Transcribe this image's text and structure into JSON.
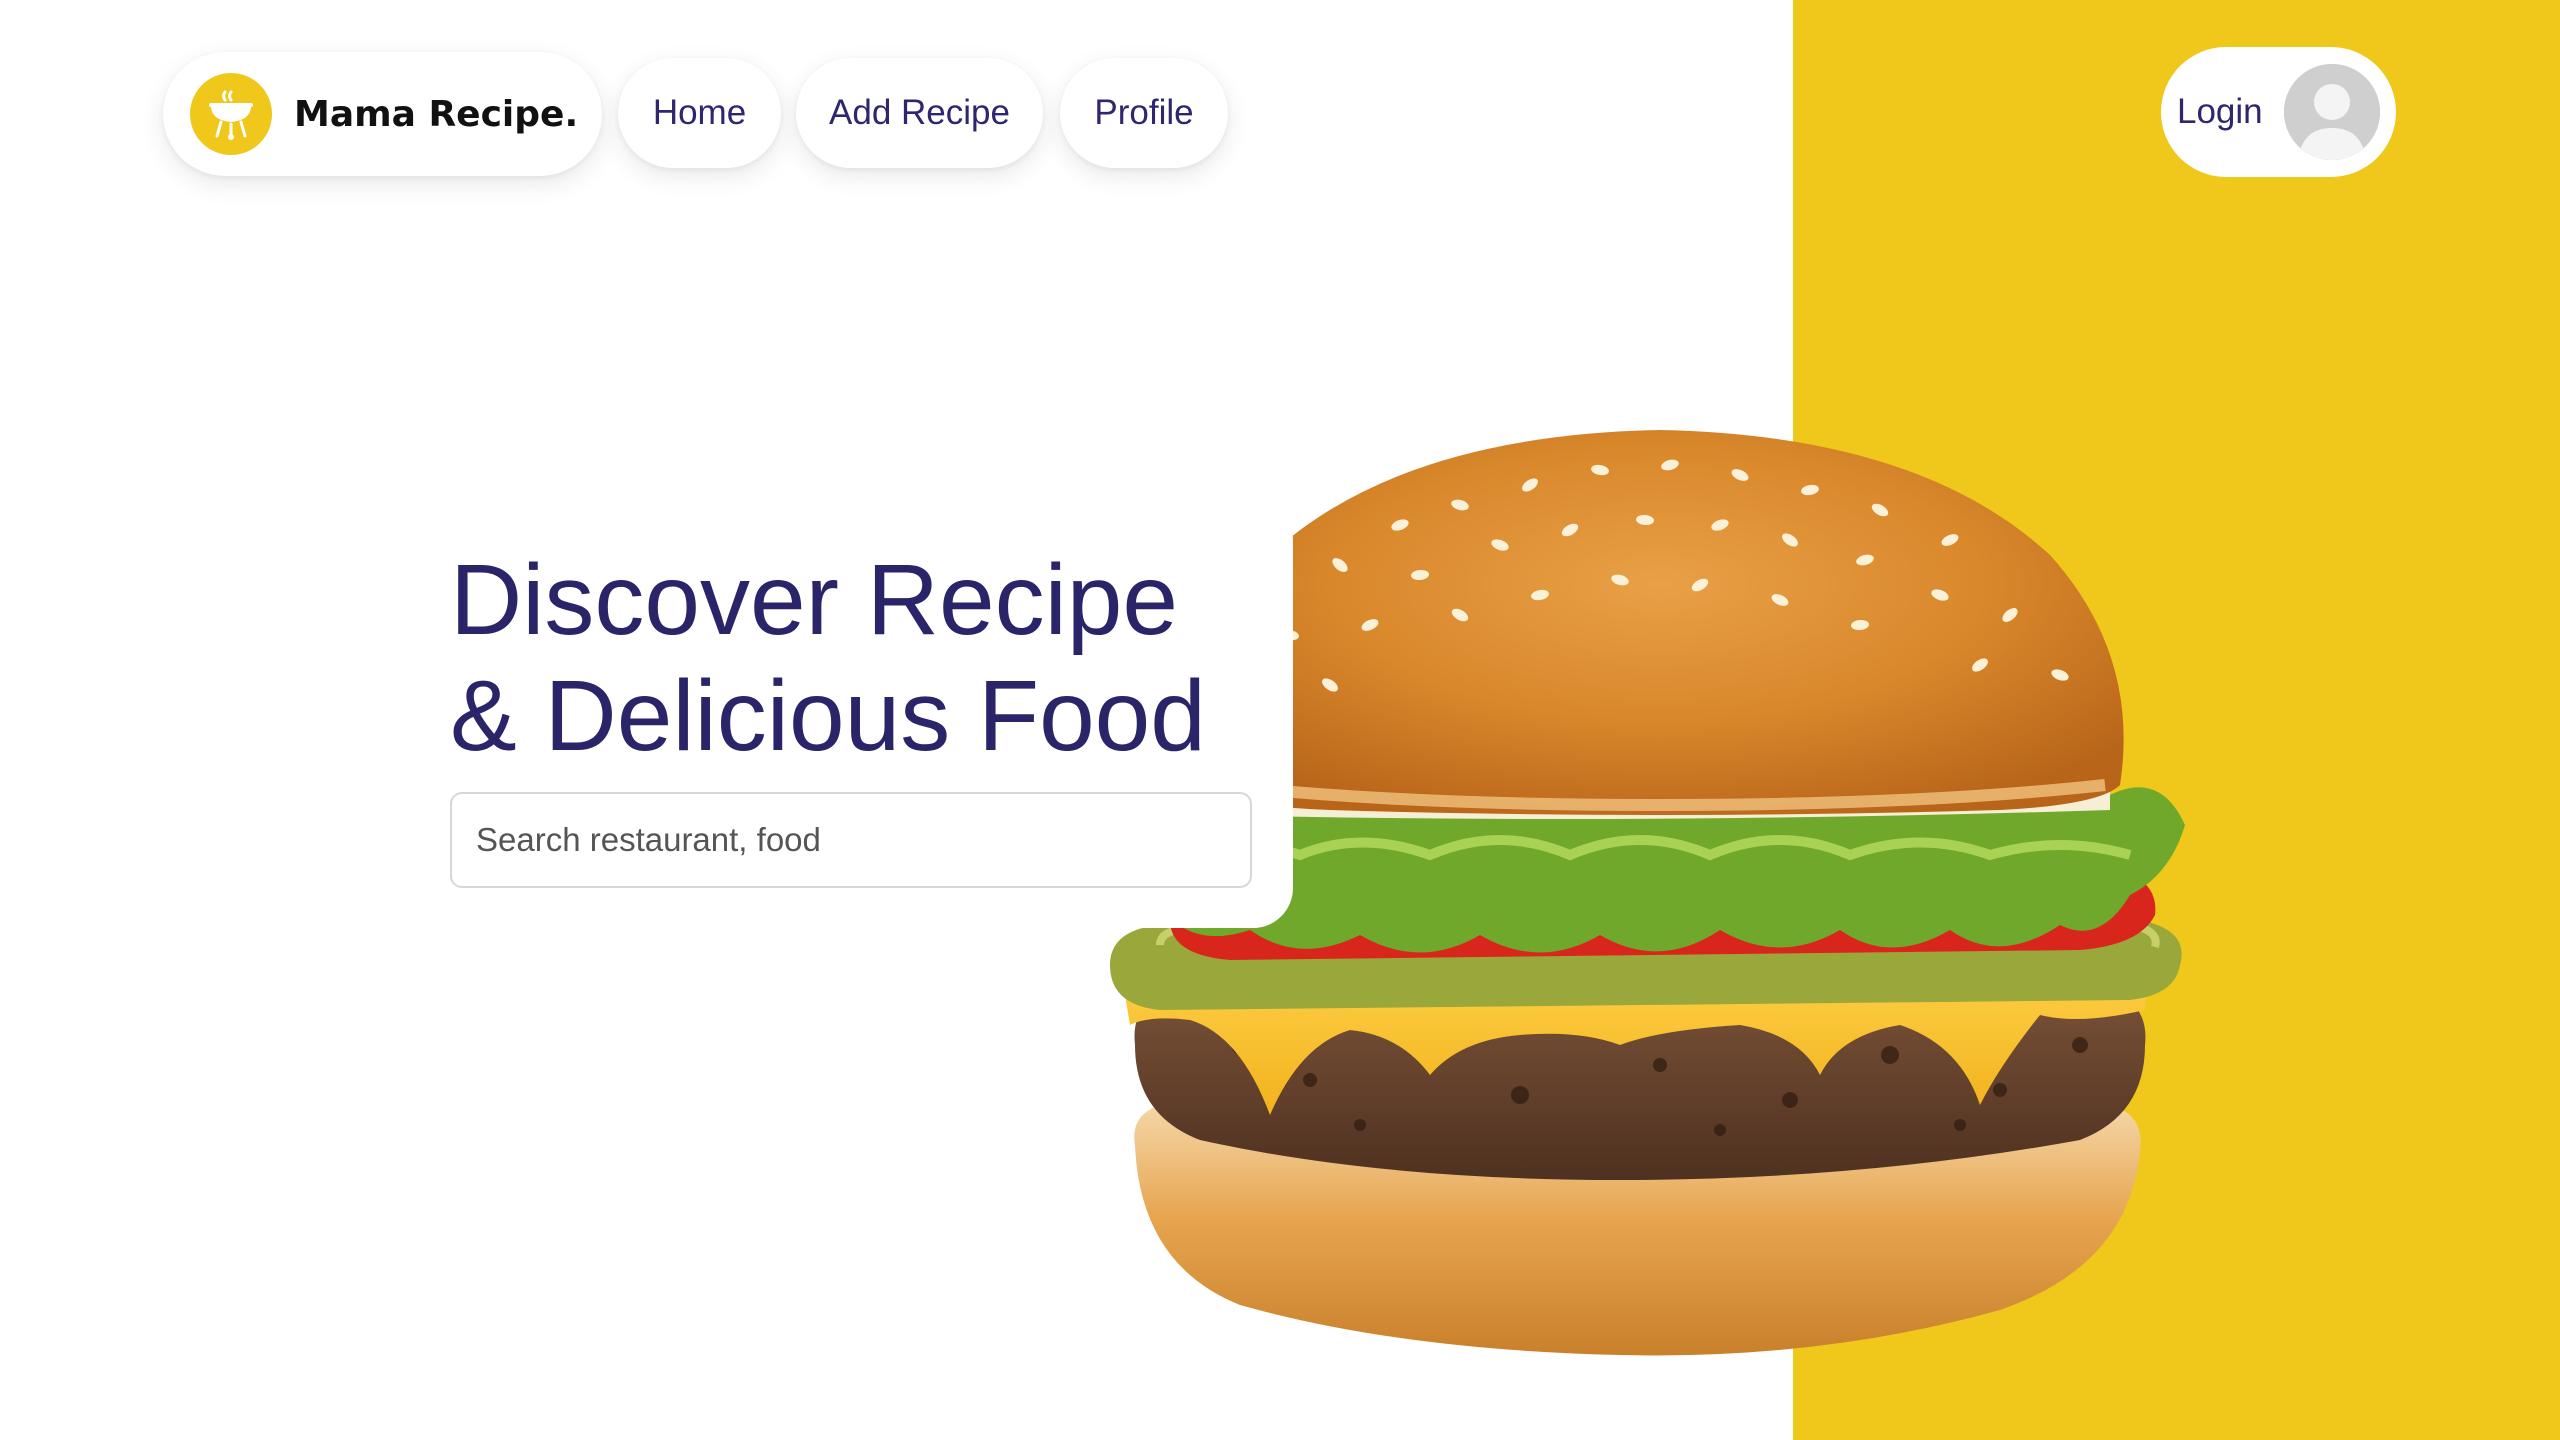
{
  "brand": {
    "name": "Mama Recipe.",
    "logo_icon": "grill-icon"
  },
  "nav": {
    "items": [
      {
        "label": "Home"
      },
      {
        "label": "Add Recipe"
      },
      {
        "label": "Profile"
      }
    ]
  },
  "auth": {
    "login_label": "Login",
    "avatar_icon": "user-avatar-icon"
  },
  "hero": {
    "title": "Discover Recipe\n& Delicious Food",
    "search_placeholder": "Search restaurant, food",
    "image": "burger-image"
  },
  "colors": {
    "accent": "#EFC81B",
    "primary_text": "#2A2469"
  }
}
